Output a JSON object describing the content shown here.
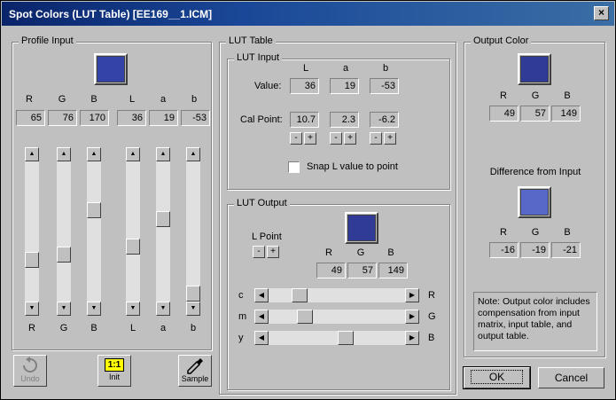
{
  "window": {
    "title": "Spot Colors (LUT Table) [EE169__1.ICM]",
    "close_glyph": "×"
  },
  "profile_input": {
    "label": "Profile Input",
    "swatch_color": "#3343a8",
    "rgb_headers": [
      "R",
      "G",
      "B"
    ],
    "rgb_values": [
      "65",
      "76",
      "170"
    ],
    "lab_headers": [
      "L",
      "a",
      "b"
    ],
    "lab_values": [
      "36",
      "19",
      "-53"
    ],
    "slider_labels": [
      "R",
      "G",
      "B",
      "L",
      "a",
      "b"
    ],
    "slider_up": "▲",
    "slider_down": "▼"
  },
  "lut_table": {
    "label": "LUT Table",
    "lut_input": {
      "label": "LUT Input",
      "headers": [
        "L",
        "a",
        "b"
      ],
      "value_label": "Value:",
      "values": [
        "36",
        "19",
        "-53"
      ],
      "cal_label": "Cal Point:",
      "cal_values": [
        "10.7",
        "2.3",
        "-6.2"
      ],
      "minus": "-",
      "plus": "+",
      "snap_label": "Snap L value to point",
      "snap_checked": false
    },
    "lut_output": {
      "label": "LUT Output",
      "lpoint_label": "L Point",
      "minus": "-",
      "plus": "+",
      "swatch_color": "#303b98",
      "headers": [
        "R",
        "G",
        "B"
      ],
      "values": [
        "49",
        "57",
        "149"
      ],
      "slider_left_labels": [
        "c",
        "m",
        "y"
      ],
      "slider_right_labels": [
        "R",
        "G",
        "B"
      ],
      "left_arrow": "◀",
      "right_arrow": "▶"
    }
  },
  "output_color": {
    "label": "Output Color",
    "swatch_color": "#303b98",
    "headers": [
      "R",
      "G",
      "B"
    ],
    "values": [
      "49",
      "57",
      "149"
    ],
    "diff_label": "Difference from Input",
    "diff_swatch_color": "#5868c8",
    "diff_headers": [
      "R",
      "G",
      "B"
    ],
    "diff_values": [
      "-16",
      "-19",
      "-21"
    ],
    "note": "Note: Output color includes compensation from input matrix, input table, and output table."
  },
  "toolbar": {
    "undo_label": "Undo",
    "init_label": "Init",
    "init_badge": "1:1",
    "sample_label": "Sample"
  },
  "buttons": {
    "ok": "OK",
    "cancel": "Cancel"
  }
}
